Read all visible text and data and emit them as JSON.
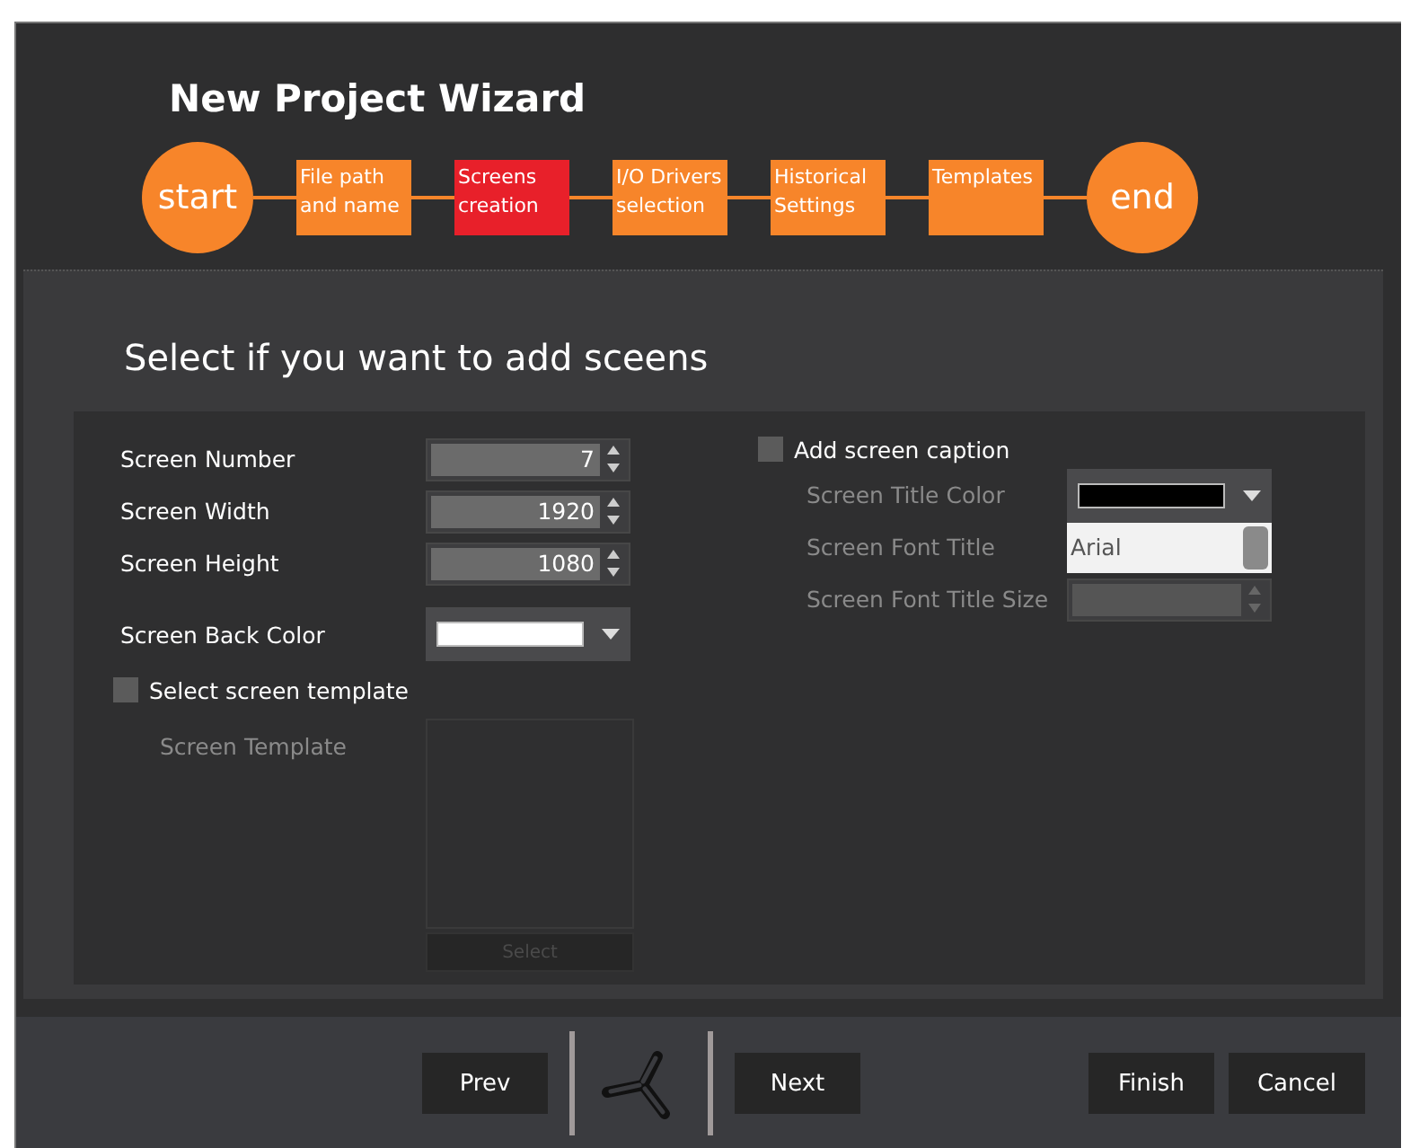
{
  "window": {
    "title": "New Project Wizard"
  },
  "steps": [
    {
      "kind": "circle",
      "lines": [
        "start"
      ],
      "selected": false
    },
    {
      "kind": "box",
      "lines": [
        "File path",
        "and name"
      ],
      "selected": false
    },
    {
      "kind": "box",
      "lines": [
        "Screens",
        "creation"
      ],
      "selected": true
    },
    {
      "kind": "box",
      "lines": [
        "I/O Drivers",
        "selection"
      ],
      "selected": false
    },
    {
      "kind": "box",
      "lines": [
        "Historical",
        "Settings"
      ],
      "selected": false
    },
    {
      "kind": "box",
      "lines": [
        "Templates"
      ],
      "selected": false
    },
    {
      "kind": "circle",
      "lines": [
        "end"
      ],
      "selected": false
    }
  ],
  "heading": "Select if you want to add sceens",
  "spinners": [
    {
      "label": "Screen Number",
      "value": "7"
    },
    {
      "label": "Screen Width",
      "value": "1920"
    },
    {
      "label": "Screen Height",
      "value": "1080"
    }
  ],
  "back_color": {
    "label": "Screen Back Color",
    "color": "#ffffff"
  },
  "template_checkbox": {
    "label": "Select screen template",
    "checked": false
  },
  "template": {
    "label": "Screen Template",
    "button": "Select",
    "disabled": true
  },
  "caption_checkbox": {
    "label": "Add screen caption",
    "checked": false
  },
  "title_color": {
    "label": "Screen Title Color",
    "color": "#000000",
    "disabled": true
  },
  "font_title": {
    "label": "Screen Font Title",
    "value": "Arial",
    "disabled": true
  },
  "font_size": {
    "label": "Screen Font Title Size",
    "disabled": true
  },
  "buttons": [
    {
      "label": "Prev",
      "kind": "nav"
    },
    {
      "kind": "logo"
    },
    {
      "label": "Next",
      "kind": "nav"
    },
    {
      "kind": "gap"
    },
    {
      "label": "Finish",
      "kind": "nav"
    },
    {
      "label": "Cancel",
      "kind": "nav"
    }
  ]
}
